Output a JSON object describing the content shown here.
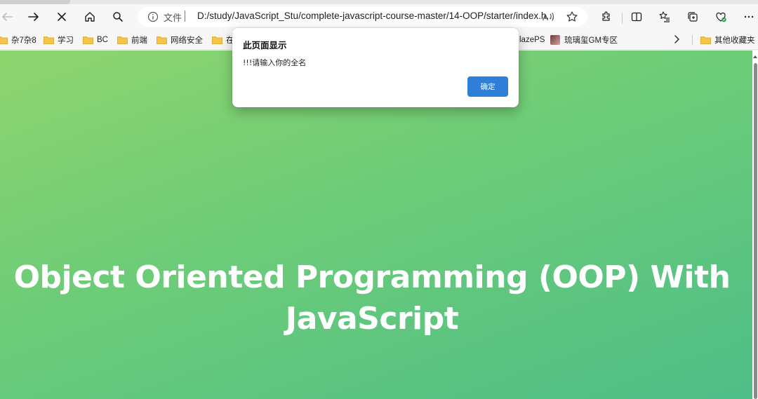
{
  "browser": {
    "address_bar": {
      "file_label": "文件",
      "url": "D:/study/JavaScript_Stu/complete-javascript-course-master/14-OOP/starter/index.h..."
    },
    "bookmarks": [
      {
        "label": "杂7杂8"
      },
      {
        "label": "学习"
      },
      {
        "label": "BC"
      },
      {
        "label": "前端"
      },
      {
        "label": "网络安全"
      },
      {
        "label": "在"
      },
      {
        "label": "lazePS"
      },
      {
        "label": "琉璃玺GM专区"
      },
      {
        "label": "其他收藏夹"
      }
    ]
  },
  "page": {
    "title": "Object Oriented Programming (OOP) With JavaScript",
    "background_gradient": [
      "#8fd46e",
      "#4fbe88"
    ]
  },
  "dialog": {
    "title": "此页面显示",
    "message": "!!!请输入你的全名",
    "ok_label": "确定",
    "ok_color": "#2f7ed8"
  }
}
